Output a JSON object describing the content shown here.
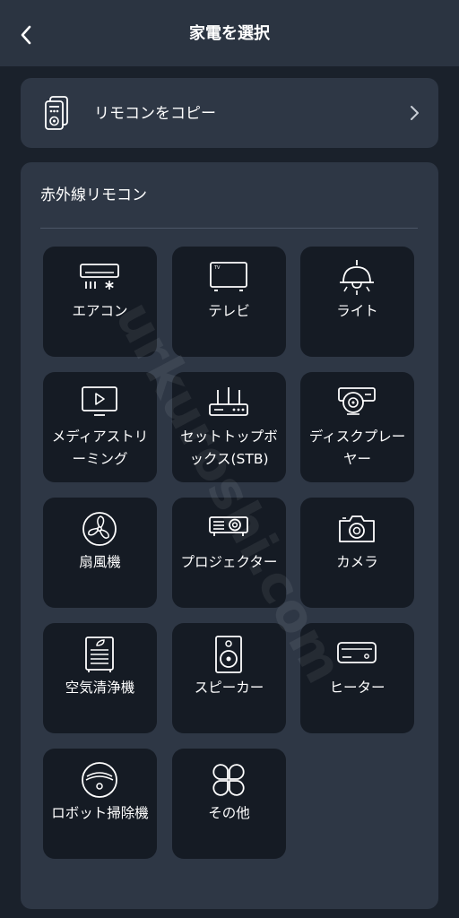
{
  "header": {
    "title": "家電を選択",
    "back_icon": "chevron-left-icon"
  },
  "copy_remote": {
    "label": "リモコンをコピー",
    "icon": "remote-copy-icon",
    "chevron_icon": "chevron-right-icon"
  },
  "ir_section": {
    "title": "赤外線リモコン",
    "devices": [
      {
        "label": "エアコン",
        "icon": "air-conditioner-icon"
      },
      {
        "label": "テレビ",
        "icon": "tv-icon"
      },
      {
        "label": "ライト",
        "icon": "ceiling-light-icon"
      },
      {
        "label": "メディアストリーミング",
        "icon": "media-streaming-icon"
      },
      {
        "label": "セットトップボックス(STB)",
        "icon": "router-stb-icon"
      },
      {
        "label": "ディスクプレーヤー",
        "icon": "disc-player-icon"
      },
      {
        "label": "扇風機",
        "icon": "fan-icon"
      },
      {
        "label": "プロジェクター",
        "icon": "projector-icon"
      },
      {
        "label": "カメラ",
        "icon": "camera-icon"
      },
      {
        "label": "空気清浄機",
        "icon": "air-purifier-icon"
      },
      {
        "label": "スピーカー",
        "icon": "speaker-icon"
      },
      {
        "label": "ヒーター",
        "icon": "heater-icon"
      },
      {
        "label": "ロボット掃除機",
        "icon": "robot-vacuum-icon"
      },
      {
        "label": "その他",
        "icon": "other-clover-icon"
      }
    ]
  },
  "watermark": "urkuroshi.com",
  "colors": {
    "background": "#1a212b",
    "header": "#2b3441",
    "card": "#2e3745",
    "tile": "#151b24",
    "text": "#ffffff"
  }
}
